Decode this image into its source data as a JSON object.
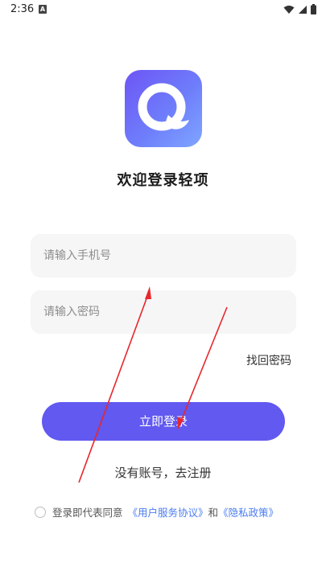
{
  "status": {
    "time": "2:36",
    "notification_letter": "A",
    "icons": [
      "wifi-icon",
      "signal-icon",
      "battery-icon"
    ]
  },
  "logo": {
    "icon": "app-q-logo-icon",
    "gradient_from": "#6d55f5",
    "gradient_to": "#7fa6ff"
  },
  "welcome": {
    "title": "欢迎登录轻项"
  },
  "form": {
    "phone_placeholder": "请输入手机号",
    "password_placeholder": "请输入密码",
    "forgot_label": "找回密码",
    "login_label": "立即登录"
  },
  "register": {
    "label": "没有账号，去注册"
  },
  "agreement": {
    "prefix": "登录即代表同意",
    "user_agreement": "《用户服务协议》",
    "and": "和",
    "privacy_policy": "《隐私政策》"
  },
  "colors": {
    "accent": "#6159f0",
    "link": "#4a7cf0",
    "annotation_arrow": "#e8262c"
  }
}
